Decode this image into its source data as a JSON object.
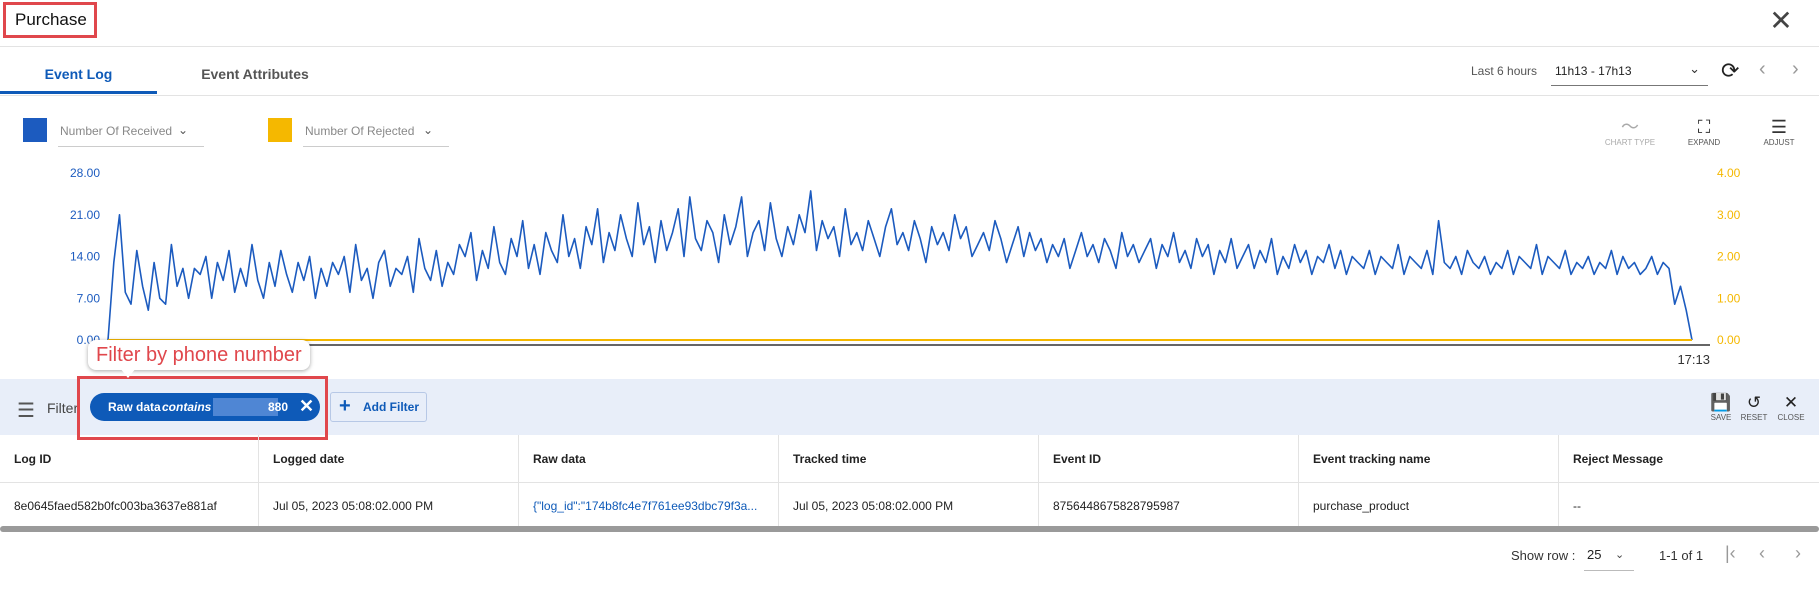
{
  "header": {
    "title": "Purchase",
    "close_icon": "close-icon"
  },
  "tabs": [
    {
      "label": "Event Log",
      "active": true
    },
    {
      "label": "Event Attributes",
      "active": false
    }
  ],
  "time_range": {
    "label": "Last 6 hours",
    "value": "11h13 - 17h13"
  },
  "legend": {
    "received": {
      "label": "Number Of Received",
      "color": "#1c5bbf"
    },
    "rejected": {
      "label": "Number Of Rejected",
      "color": "#f5b800"
    }
  },
  "chart_tools": {
    "chart_type": "CHART TYPE",
    "expand": "EXPAND",
    "adjust": "ADJUST"
  },
  "chart_data": {
    "type": "line",
    "left_axis": {
      "ticks": [
        "28.00",
        "21.00",
        "14.00",
        "7.00",
        "0.00"
      ],
      "ylim": [
        0,
        28
      ]
    },
    "right_axis": {
      "ticks": [
        "4.00",
        "3.00",
        "2.00",
        "1.00",
        "0.00"
      ],
      "ylim": [
        0,
        4
      ]
    },
    "x_end_label": "17:13",
    "series": [
      {
        "axis": "left",
        "color": "#1c5bbf",
        "values": [
          0,
          13,
          21,
          8,
          6,
          15,
          9,
          5,
          13,
          7,
          6,
          16,
          9,
          12,
          7,
          12,
          11,
          14,
          7,
          13,
          10,
          15,
          8,
          12,
          9,
          16,
          10,
          7,
          13,
          9,
          15,
          11,
          8,
          13,
          10,
          14,
          7,
          12,
          9,
          13,
          11,
          14,
          8,
          16,
          10,
          12,
          7,
          13,
          15,
          9,
          12,
          11,
          14,
          8,
          17,
          12,
          10,
          15,
          9,
          13,
          11,
          16,
          14,
          18,
          10,
          15,
          12,
          19,
          13,
          11,
          17,
          14,
          20,
          12,
          16,
          11,
          18,
          15,
          13,
          21,
          14,
          17,
          12,
          19,
          16,
          22,
          13,
          18,
          15,
          21,
          17,
          14,
          23,
          16,
          19,
          13,
          20,
          15,
          18,
          22,
          14,
          24,
          17,
          15,
          20,
          18,
          13,
          21,
          16,
          19,
          24,
          14,
          18,
          20,
          15,
          23,
          17,
          14,
          19,
          16,
          21,
          18,
          25,
          15,
          20,
          17,
          19,
          14,
          22,
          16,
          18,
          15,
          20,
          17,
          14,
          19,
          22,
          16,
          18,
          15,
          20,
          17,
          13,
          19,
          16,
          18,
          15,
          21,
          17,
          19,
          14,
          16,
          18,
          15,
          20,
          17,
          13,
          16,
          19,
          14,
          18,
          15,
          17,
          13,
          16,
          14,
          17,
          12,
          15,
          18,
          14,
          16,
          13,
          17,
          15,
          12,
          18,
          14,
          16,
          13,
          15,
          17,
          12,
          16,
          14,
          18,
          13,
          15,
          12,
          17,
          14,
          16,
          11,
          15,
          13,
          17,
          12,
          14,
          16,
          12,
          15,
          13,
          17,
          11,
          14,
          12,
          16,
          13,
          15,
          11,
          14,
          13,
          16,
          12,
          15,
          11,
          14,
          13,
          12,
          15,
          11,
          14,
          13,
          12,
          16,
          11,
          14,
          13,
          12,
          15,
          11,
          20,
          13,
          12,
          14,
          11,
          15,
          13,
          12,
          14,
          11,
          13,
          12,
          15,
          11,
          14,
          13,
          12,
          16,
          11,
          14,
          13,
          12,
          15,
          11,
          13,
          12,
          14,
          11,
          13,
          12,
          15,
          11,
          14,
          12,
          13,
          11,
          12,
          14,
          11,
          13,
          12,
          6,
          9,
          5,
          0
        ]
      },
      {
        "axis": "right",
        "color": "#f5b800",
        "values": [
          0,
          0
        ]
      }
    ]
  },
  "annotation": {
    "callout": "Filter by phone number"
  },
  "filter": {
    "label": "Filter",
    "chip": {
      "field": "Raw data",
      "operator": "contains",
      "value_suffix": "880"
    },
    "add_label": "Add Filter",
    "save": "SAVE",
    "reset": "RESET",
    "close": "CLOSE"
  },
  "table": {
    "columns": [
      "Log ID",
      "Logged date",
      "Raw data",
      "Tracked time",
      "Event ID",
      "Event tracking name",
      "Reject Message"
    ],
    "rows": [
      [
        "8e0645faed582b0fc003ba3637e881af",
        "Jul 05, 2023 05:08:02.000 PM",
        "{\"log_id\":\"174b8fc4e7f761ee93dbc79f3a...",
        "Jul 05, 2023 05:08:02.000 PM",
        "8756448675828795987",
        "purchase_product",
        "--"
      ]
    ]
  },
  "pagination": {
    "show_row_label": "Show row :",
    "rows_per_page": "25",
    "range": "1-1 of 1"
  }
}
